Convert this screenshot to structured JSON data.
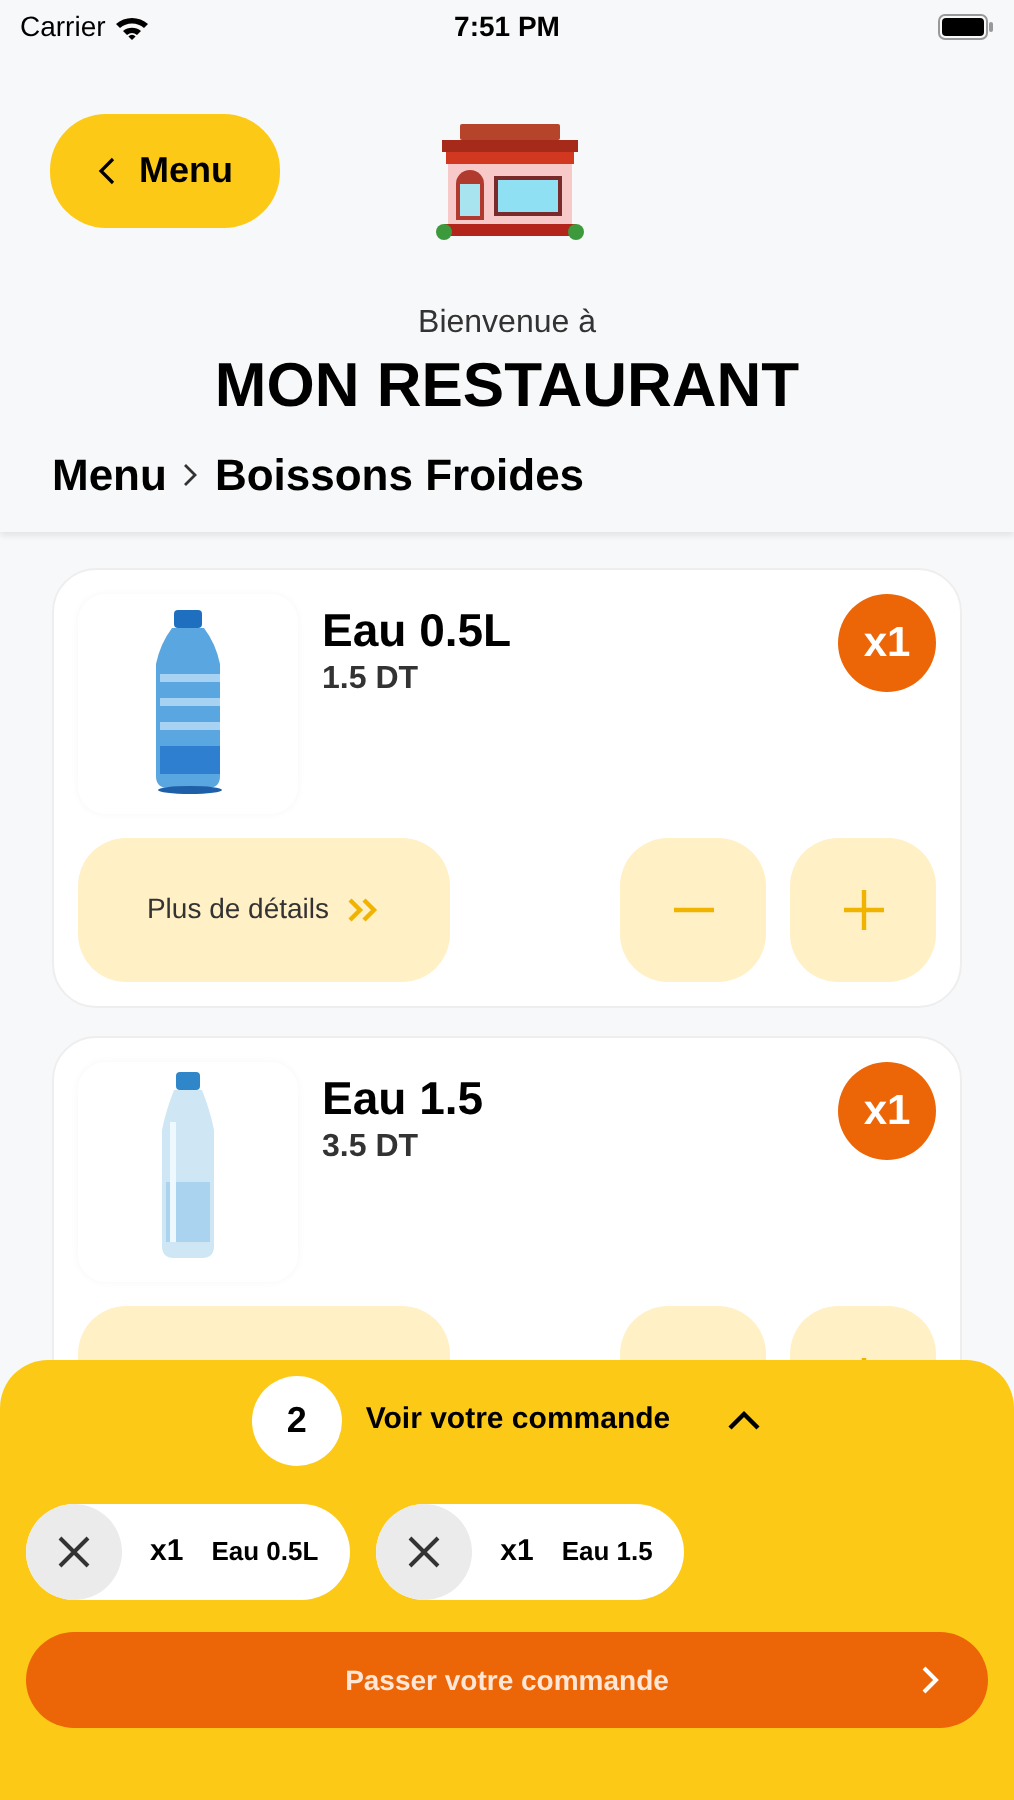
{
  "status_bar": {
    "carrier": "Carrier",
    "time": "7:51 PM"
  },
  "header": {
    "back_label": "Menu",
    "welcome": "Bienvenue à",
    "restaurant_name": "MON RESTAURANT"
  },
  "breadcrumb": [
    {
      "label": "Menu"
    },
    {
      "label": "Boissons Froides"
    }
  ],
  "products": [
    {
      "name": "Eau 0.5L",
      "price": "1.5 DT",
      "quantity": "x1",
      "details_label": "Plus de détails"
    },
    {
      "name": "Eau 1.5",
      "price": "3.5 DT",
      "quantity": "x1"
    }
  ],
  "order_sheet": {
    "count": "2",
    "title": "Voir votre commande",
    "expanded": true,
    "items": [
      {
        "quantity": "x1",
        "name": "Eau 0.5L"
      },
      {
        "quantity": "x1",
        "name": "Eau 1.5"
      }
    ],
    "submit_label": "Passer votre commande"
  }
}
